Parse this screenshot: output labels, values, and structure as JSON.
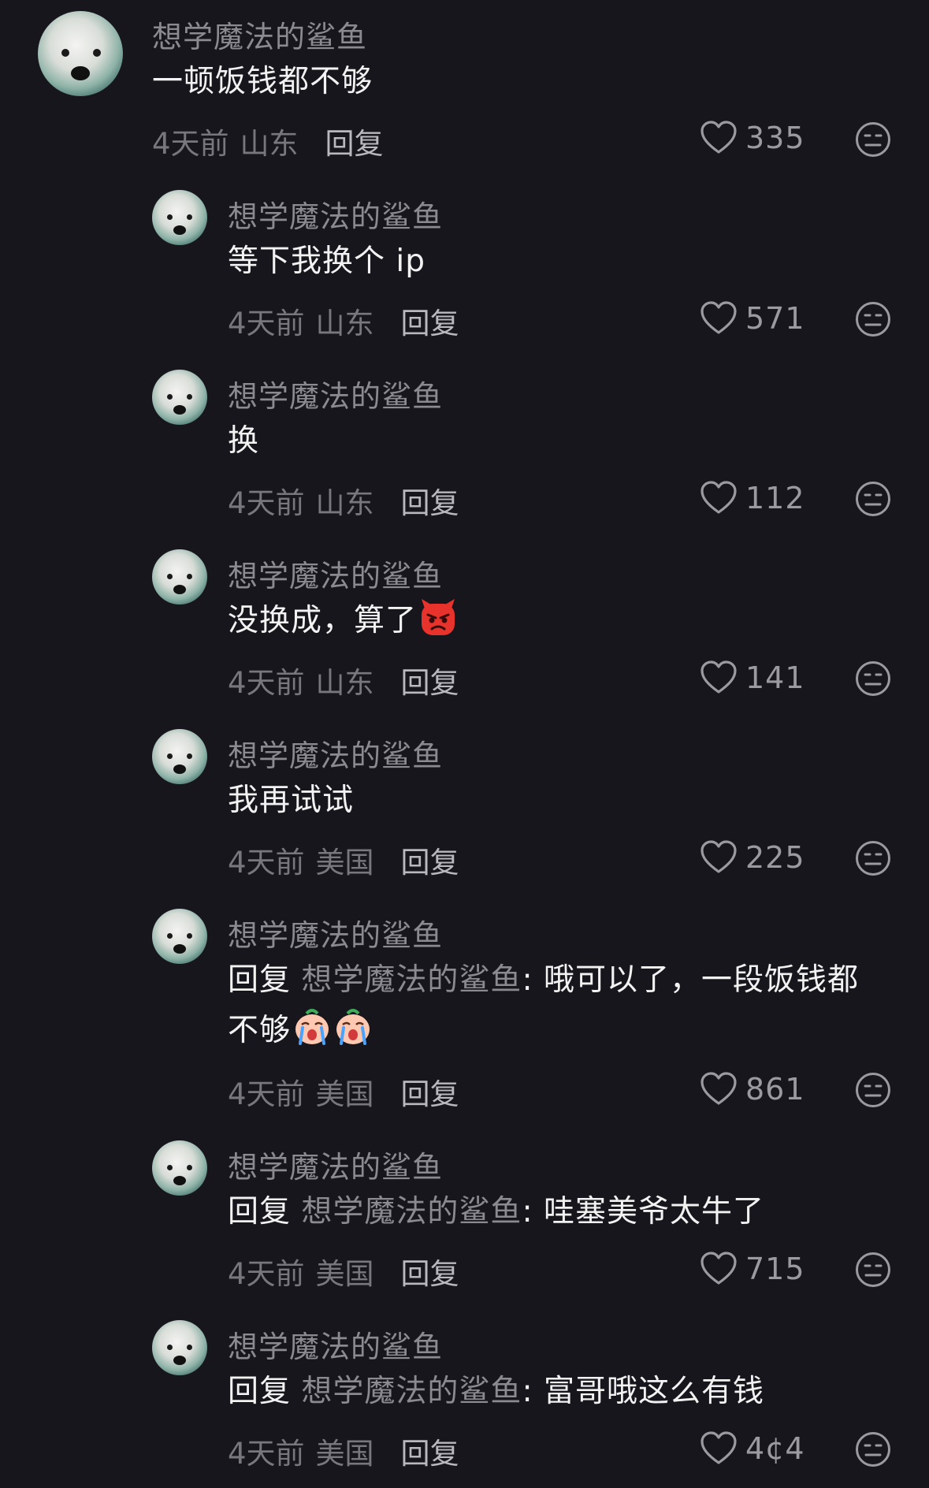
{
  "comments": [
    {
      "username": "想学魔法的鲨鱼",
      "text": "一顿饭钱都不够",
      "time": "4天前",
      "location": "山东",
      "reply_label": "回复",
      "likes": "335"
    },
    {
      "username": "想学魔法的鲨鱼",
      "text": "等下我换个 ip",
      "time": "4天前",
      "location": "山东",
      "reply_label": "回复",
      "likes": "571"
    },
    {
      "username": "想学魔法的鲨鱼",
      "text": "换",
      "time": "4天前",
      "location": "山东",
      "reply_label": "回复",
      "likes": "112"
    },
    {
      "username": "想学魔法的鲨鱼",
      "text": "没换成，算了",
      "emoji": "angry-devil-emoji",
      "time": "4天前",
      "location": "山东",
      "reply_label": "回复",
      "likes": "141"
    },
    {
      "username": "想学魔法的鲨鱼",
      "text": "我再试试",
      "time": "4天前",
      "location": "美国",
      "reply_label": "回复",
      "likes": "225"
    },
    {
      "username": "想学魔法的鲨鱼",
      "reply_prefix": "回复",
      "reply_target": "想学魔法的鲨鱼",
      "text_line1": ": 哦可以了，一段饭钱都",
      "text_line2": "不够",
      "emoji": "crying-emoji",
      "time": "4天前",
      "location": "美国",
      "reply_label": "回复",
      "likes": "861"
    },
    {
      "username": "想学魔法的鲨鱼",
      "reply_prefix": "回复",
      "reply_target": "想学魔法的鲨鱼",
      "text": ": 哇塞美爷太牛了",
      "time": "4天前",
      "location": "美国",
      "reply_label": "回复",
      "likes": "715"
    },
    {
      "username": "想学魔法的鲨鱼",
      "reply_prefix": "回复",
      "reply_target": "想学魔法的鲨鱼",
      "text": ": 富哥哦这么有钱",
      "time": "4天前",
      "location": "美国",
      "reply_label": "回复",
      "likes": "4¢4"
    }
  ],
  "icons": {
    "like": "heart-icon",
    "dislike": "meh-face-icon",
    "avatar": "polar-bear-avatar"
  },
  "colors": {
    "background": "#16161c",
    "username": "#8a8a90",
    "text": "#f2f2f2",
    "meta": "#77777d"
  }
}
